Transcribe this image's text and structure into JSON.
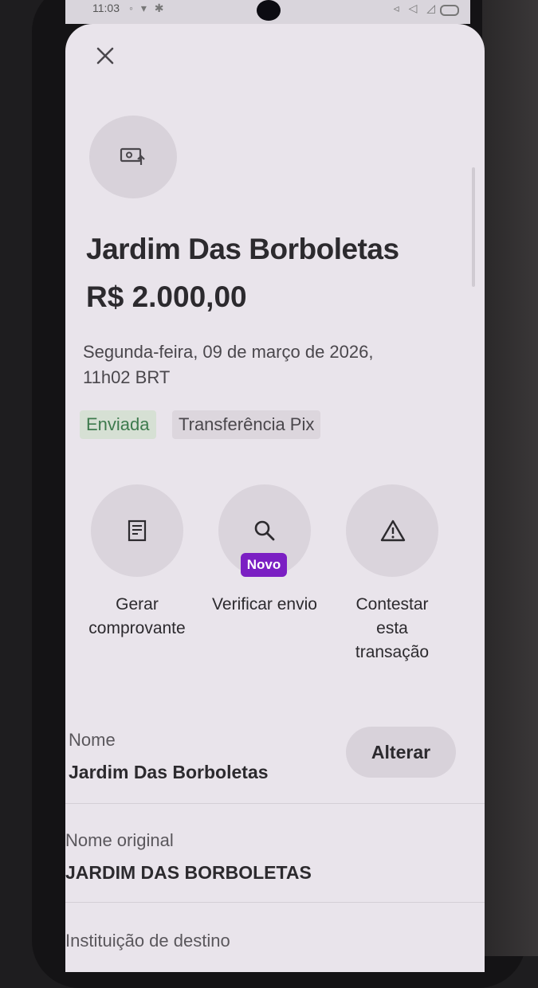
{
  "status_bar": {
    "time": "11:03",
    "left_icons": "◦ ▾ ✱",
    "right_icons": "◃ ◁ ◿"
  },
  "header": {
    "close_icon": "close-icon",
    "transaction_icon": "money-sent-icon"
  },
  "transaction": {
    "title": "Jardim Das Borboletas",
    "amount": "R$ 2.000,00",
    "datetime_line1": "Segunda-feira, 09 de março de 2026,",
    "datetime_line2": "11h02 BRT",
    "status_tag": "Enviada",
    "type_tag": "Transferência Pix"
  },
  "actions": [
    {
      "label_line1": "Gerar",
      "label_line2": "comprovante",
      "icon": "receipt-icon"
    },
    {
      "label_line1": "Verificar envio",
      "icon": "search-icon",
      "badge": "Novo"
    },
    {
      "label_line1": "Contestar",
      "label_line2": "esta",
      "label_line3": "transação",
      "icon": "warning-icon"
    }
  ],
  "details": {
    "name_label": "Nome",
    "name_value": "Jardim Das Borboletas",
    "change_button": "Alterar",
    "original_name_label": "Nome original",
    "original_name_value": "JARDIM DAS BORBOLETAS",
    "destination_label": "Instituição de destino"
  },
  "colors": {
    "screen_bg": "#e9e4eb",
    "badge_purple": "#7b1fc3",
    "status_green": "#3d7a4d",
    "status_green_bg": "#d6e0d4"
  }
}
